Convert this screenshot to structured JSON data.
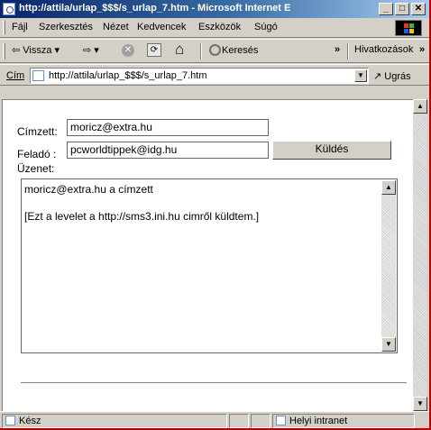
{
  "window": {
    "title": "http://attila/urlap_$$$/s_urlap_7.htm - Microsoft Internet E",
    "controls": [
      "_",
      "□",
      "✕"
    ]
  },
  "menu": {
    "items": [
      {
        "label": "Fájl"
      },
      {
        "label": "Szerkesztés"
      },
      {
        "label": "Nézet"
      },
      {
        "label": "Kedvencek"
      },
      {
        "label": "Eszközök"
      },
      {
        "label": "Súgó"
      }
    ]
  },
  "toolbar": {
    "back_label": "⇦ Vissza ▾",
    "forward_label": "⇨ ▾",
    "stop_icon": "✕",
    "refresh_icon": "⟳",
    "home_icon": "⌂",
    "search_label": "Keresés",
    "chevron": "»",
    "links_label": "Hivatkozások",
    "links_chevron": "»"
  },
  "address": {
    "label": "Cím",
    "url": "http://attila/urlap_$$$/s_urlap_7.htm",
    "go_label": "Ugrás"
  },
  "form": {
    "to_label": "Címzett:",
    "to_value": "moricz@extra.hu",
    "from_label": "Feladó :",
    "from_value": "pcworldtippek@idg.hu",
    "send_label": "Küldés",
    "message_label": "Üzenet:",
    "message_line1": "moricz@extra.hu a címzett",
    "message_line2": "[Ezt a levelet a http://sms3.ini.hu cimről küldtem.]"
  },
  "status": {
    "left": "Kész",
    "zone": "Helyi intranet"
  },
  "colors": {
    "title_start": "#0a246a",
    "title_end": "#a6caf0",
    "chrome": "#d4d0c8",
    "frame_accent": "#c00000"
  }
}
